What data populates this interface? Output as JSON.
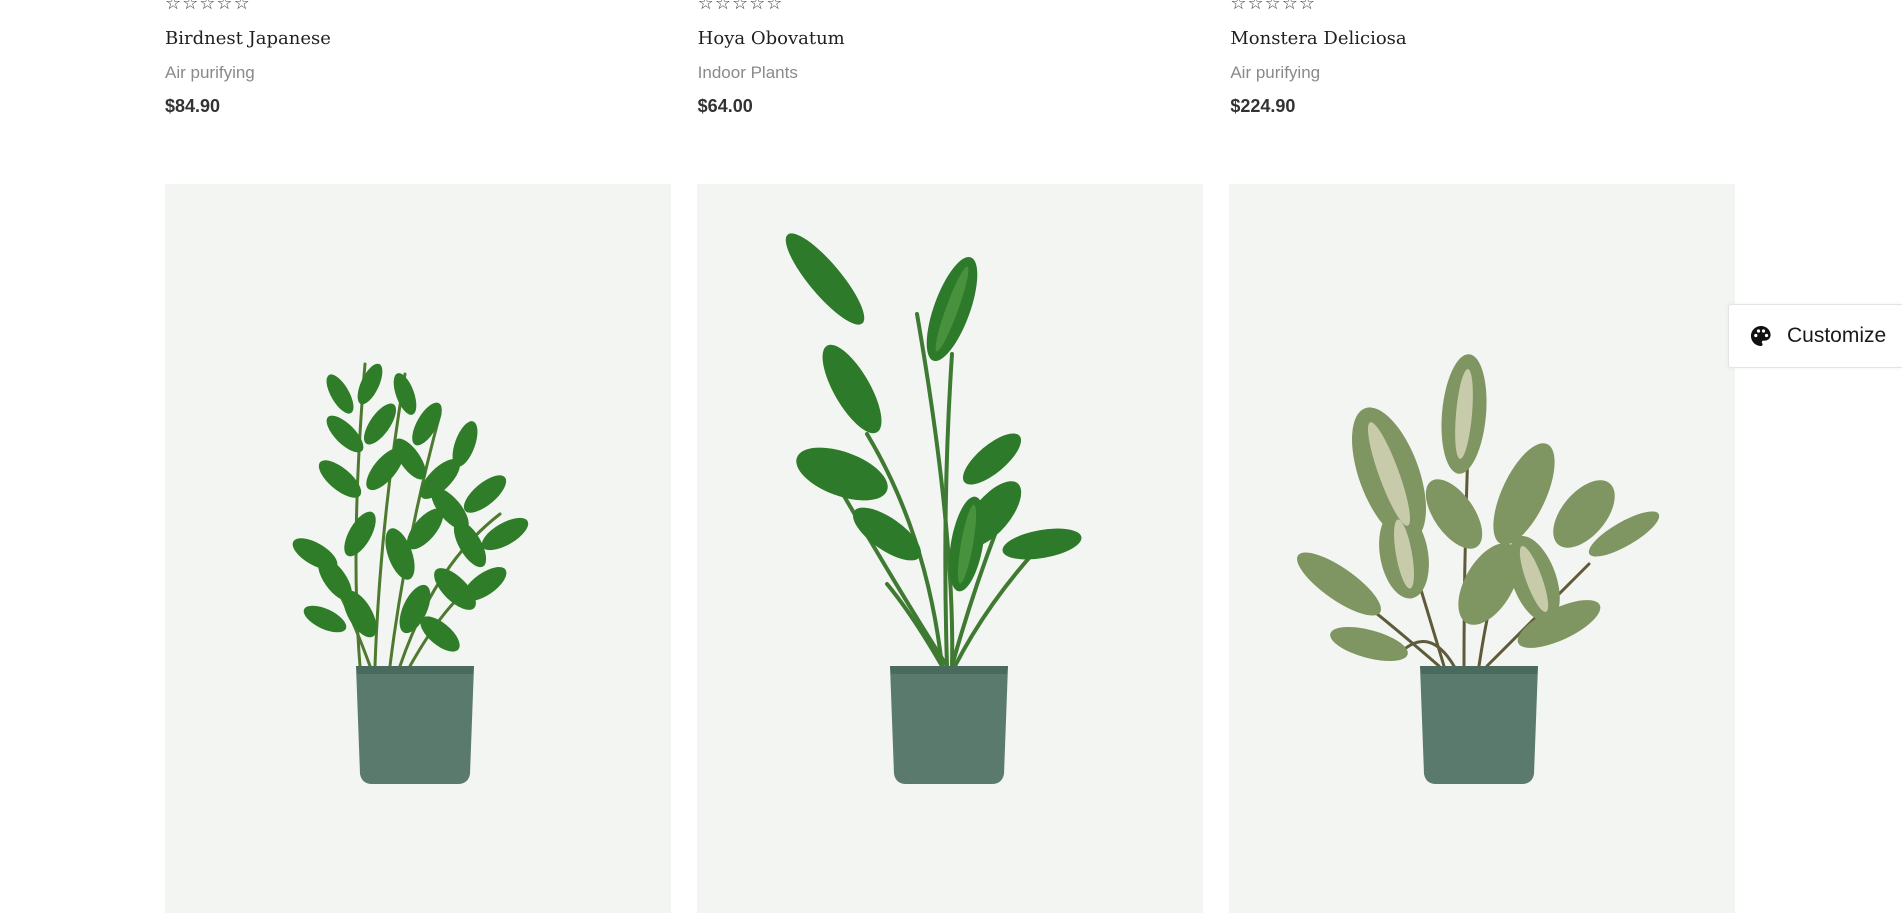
{
  "products_top": [
    {
      "rating_stars": 5,
      "rating_value": 0,
      "name": "Birdnest Japanese",
      "category": "Air purifying",
      "price": "$84.90"
    },
    {
      "rating_stars": 5,
      "rating_value": 0,
      "name": "Hoya Obovatum",
      "category": "Indoor Plants",
      "price": "$64.00"
    },
    {
      "rating_stars": 5,
      "rating_value": 0,
      "name": "Monstera Deliciosa",
      "category": "Air purifying",
      "price": "$224.90"
    }
  ],
  "products_images": [
    {
      "image": "zz-plant-in-green-pot"
    },
    {
      "image": "bird-of-paradise-in-green-pot"
    },
    {
      "image": "variegated-rubber-plant-in-green-pot"
    }
  ],
  "customize": {
    "label": "Customize",
    "icon": "palette-icon"
  },
  "colors": {
    "image_background": "#f3f5f2",
    "pot": "#5b7a6e",
    "price_text": "#333333",
    "category_text": "#8a8a8a"
  }
}
